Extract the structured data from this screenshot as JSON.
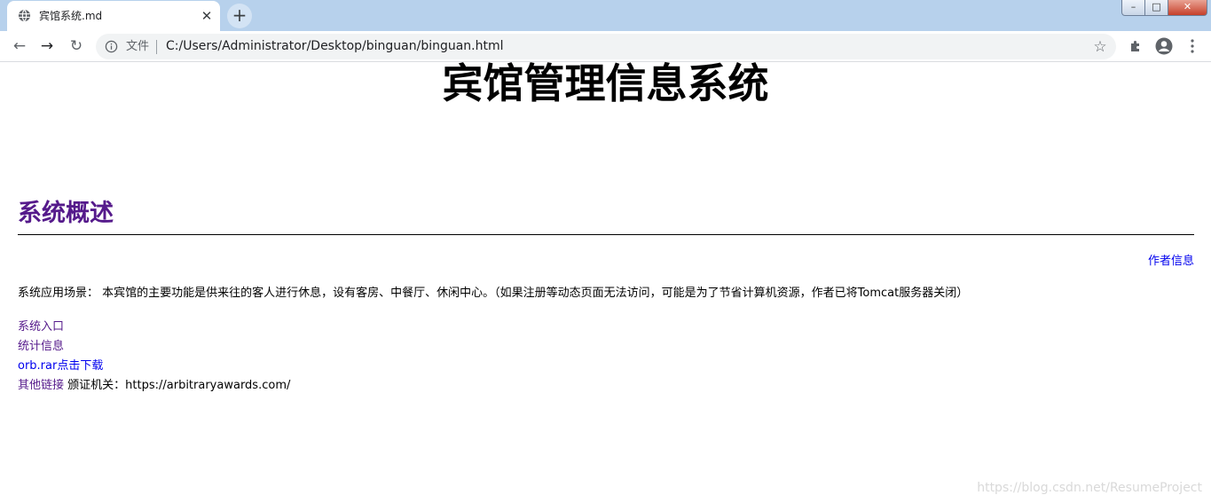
{
  "browser": {
    "tab_title": "宾馆系统.md",
    "tab_close": "✕",
    "new_tab": "+",
    "back": "←",
    "forward": "→",
    "reload": "↻",
    "file_label": "文件",
    "url": "C:/Users/Administrator/Desktop/binguan/binguan.html",
    "bookmark": "☆",
    "window_min": "–",
    "window_max": "□",
    "window_close": "✕"
  },
  "page": {
    "title": "宾馆管理信息系统",
    "section_heading": "系统概述",
    "author_link": "作者信息",
    "scene_text": "系统应用场景： 本宾馆的主要功能是供来往的客人进行休息，设有客房、中餐厅、休闲中心。（如果注册等动态页面无法访问，可能是为了节省计算机资源，作者已将Tomcat服务器关闭）",
    "links": {
      "entry": "系统入口",
      "stats": "统计信息",
      "download": "orb.rar点击下载",
      "other": "其他链接",
      "issuer": "颁证机关：https://arbitraryawards.com/"
    },
    "watermark": "https://blog.csdn.net/ResumeProject"
  },
  "colors": {
    "visited_link": "#551a8b",
    "link": "#0000ee",
    "tabstrip": "#b7d1ec"
  }
}
